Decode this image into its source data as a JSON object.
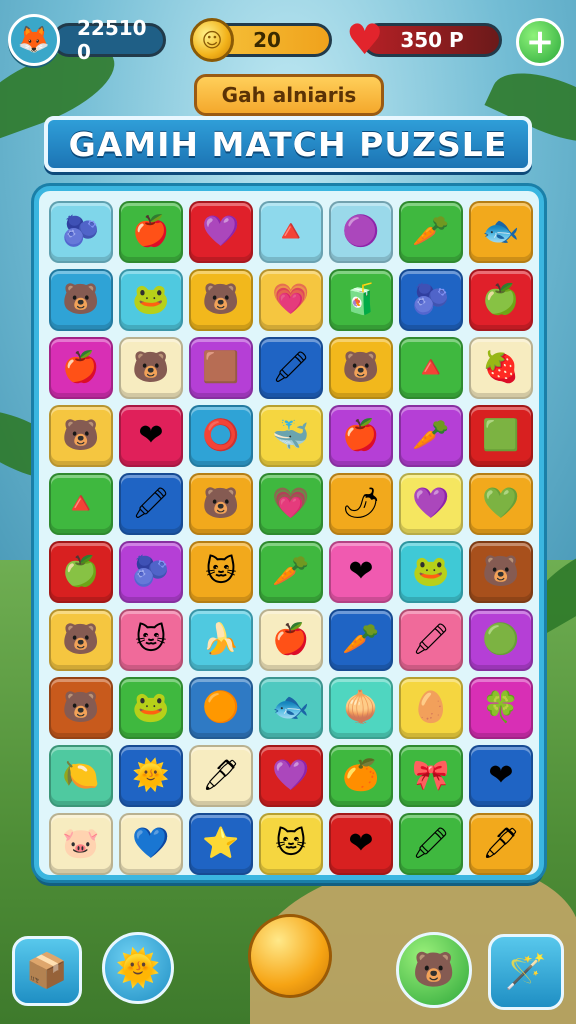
{
  "hud": {
    "score": "22510 0",
    "coins": "20",
    "lives": "350 P",
    "avatar_icon": "🦊",
    "coin_icon": "☺",
    "heart_icon": "♥",
    "add_icon": "+"
  },
  "title": {
    "subtitle": "Gah alniaris",
    "main": "GAMIH MATCH PUZSLE"
  },
  "board": {
    "rows": [
      [
        {
          "c": "#7fd6ea",
          "i": "🫐"
        },
        {
          "c": "#3fb83f",
          "i": "🍎"
        },
        {
          "c": "#e0202a",
          "i": "💜"
        },
        {
          "c": "#8ed9ec",
          "i": "🔺"
        },
        {
          "c": "#9ad9ea",
          "i": "🟣"
        },
        {
          "c": "#3fb83f",
          "i": "🥕"
        },
        {
          "c": "#f2a91c",
          "i": "🐟"
        }
      ],
      [
        {
          "c": "#2fa3d6",
          "i": "🐻"
        },
        {
          "c": "#4fc9e0",
          "i": "🐸"
        },
        {
          "c": "#f2b81c",
          "i": "🐻"
        },
        {
          "c": "#f5c640",
          "i": "💗"
        },
        {
          "c": "#3fb83f",
          "i": "🧃"
        },
        {
          "c": "#1f64c4",
          "i": "🫐"
        },
        {
          "c": "#e0202a",
          "i": "🍏"
        }
      ],
      [
        {
          "c": "#d82fb5",
          "i": "🍎"
        },
        {
          "c": "#f7ecc0",
          "i": "🐻"
        },
        {
          "c": "#b53fd6",
          "i": "🟫"
        },
        {
          "c": "#1f64c4",
          "i": "🖍"
        },
        {
          "c": "#f2b81c",
          "i": "🐻"
        },
        {
          "c": "#3fb83f",
          "i": "🔺"
        },
        {
          "c": "#f7ecc0",
          "i": "🍓"
        }
      ],
      [
        {
          "c": "#f5c640",
          "i": "🐻"
        },
        {
          "c": "#e0205a",
          "i": "❤"
        },
        {
          "c": "#2fa3d6",
          "i": "⭕"
        },
        {
          "c": "#f5d640",
          "i": "🐳"
        },
        {
          "c": "#b53fd6",
          "i": "🍎"
        },
        {
          "c": "#b53fd6",
          "i": "🥕"
        },
        {
          "c": "#d82020",
          "i": "🟩"
        }
      ],
      [
        {
          "c": "#3fb83f",
          "i": "🔺"
        },
        {
          "c": "#1f64c4",
          "i": "🖍"
        },
        {
          "c": "#f2a91c",
          "i": "🐻"
        },
        {
          "c": "#3fb83f",
          "i": "💗"
        },
        {
          "c": "#f2a91c",
          "i": "🌶"
        },
        {
          "c": "#f5e660",
          "i": "💜"
        },
        {
          "c": "#f2a91c",
          "i": "💚"
        }
      ],
      [
        {
          "c": "#d82020",
          "i": "🍏"
        },
        {
          "c": "#b53fd6",
          "i": "🫐"
        },
        {
          "c": "#f2a91c",
          "i": "🐱"
        },
        {
          "c": "#3fb83f",
          "i": "🥕"
        },
        {
          "c": "#f05ab0",
          "i": "❤"
        },
        {
          "c": "#3fc9d6",
          "i": "🐸"
        },
        {
          "c": "#a8501c",
          "i": "🐻"
        }
      ],
      [
        {
          "c": "#f5c640",
          "i": "🐻"
        },
        {
          "c": "#f06a9a",
          "i": "🐱"
        },
        {
          "c": "#4fc9e0",
          "i": "🍌"
        },
        {
          "c": "#f7ecc0",
          "i": "🍎"
        },
        {
          "c": "#1f64c4",
          "i": "🥕"
        },
        {
          "c": "#f06a9a",
          "i": "🖍"
        },
        {
          "c": "#b53fd6",
          "i": "🟢"
        }
      ],
      [
        {
          "c": "#c85a1c",
          "i": "🐻"
        },
        {
          "c": "#3fb83f",
          "i": "🐸"
        },
        {
          "c": "#2f7ac4",
          "i": "🟠"
        },
        {
          "c": "#4fc9c0",
          "i": "🐟"
        },
        {
          "c": "#4fd6c0",
          "i": "🧅"
        },
        {
          "c": "#f5d640",
          "i": "🥚"
        },
        {
          "c": "#d82fb5",
          "i": "🍀"
        }
      ],
      [
        {
          "c": "#4fc9a0",
          "i": "🍋"
        },
        {
          "c": "#1f64c4",
          "i": "🌞"
        },
        {
          "c": "#f7ecc0",
          "i": "🖊"
        },
        {
          "c": "#d82020",
          "i": "💜"
        },
        {
          "c": "#3fb83f",
          "i": "🍊"
        },
        {
          "c": "#3fb83f",
          "i": "🎀"
        },
        {
          "c": "#1f64c4",
          "i": "❤"
        }
      ],
      [
        {
          "c": "#f7ecc0",
          "i": "🐷"
        },
        {
          "c": "#f7ecc0",
          "i": "💙"
        },
        {
          "c": "#1f64c4",
          "i": "⭐"
        },
        {
          "c": "#f5d640",
          "i": "🐱"
        },
        {
          "c": "#d82020",
          "i": "❤"
        },
        {
          "c": "#3fb83f",
          "i": "🖍"
        },
        {
          "c": "#f2a91c",
          "i": "🖊"
        }
      ]
    ]
  },
  "toolbar": {
    "box_icon": "📦",
    "sun_icon": "🌞",
    "hint_icon": "🐻",
    "wand_icon": "🪄"
  }
}
